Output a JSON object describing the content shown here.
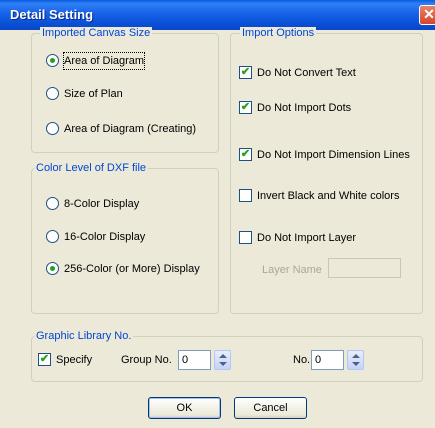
{
  "window": {
    "title": "Detail Setting",
    "close_glyph": "✕"
  },
  "canvas_size": {
    "legend": "Imported Canvas Size",
    "options": [
      "Area of Diagram",
      "Size of Plan",
      "Area of Diagram (Creating)"
    ],
    "selected": "Area of Diagram"
  },
  "color_level": {
    "legend": "Color Level of DXF file",
    "options": [
      "8-Color Display",
      "16-Color Display",
      "256-Color (or More) Display"
    ],
    "selected": "256-Color (or More) Display"
  },
  "import_options": {
    "legend": "Import Options",
    "checks": [
      {
        "label": "Do Not Convert Text",
        "checked": true
      },
      {
        "label": "Do Not Import Dots",
        "checked": true
      },
      {
        "label": "Do Not Import Dimension Lines",
        "checked": true
      },
      {
        "label": "Invert Black and White colors",
        "checked": false
      },
      {
        "label": "Do Not Import Layer",
        "checked": false
      }
    ],
    "layer_name_label": "Layer Name",
    "layer_name_value": ""
  },
  "graphic_library": {
    "legend": "Graphic Library No.",
    "specify_label": "Specify",
    "specify_checked": true,
    "group_label": "Group No.",
    "group_value": "0",
    "no_label": "No.",
    "no_value": "0"
  },
  "buttons": {
    "ok": "OK",
    "cancel": "Cancel"
  },
  "check_glyph": "✔",
  "colors": {
    "legend_text": "#0046d5",
    "title_bar": "#0a5ce0",
    "check_mark": "#21a121",
    "dialog_bg": "#ece9d8"
  }
}
